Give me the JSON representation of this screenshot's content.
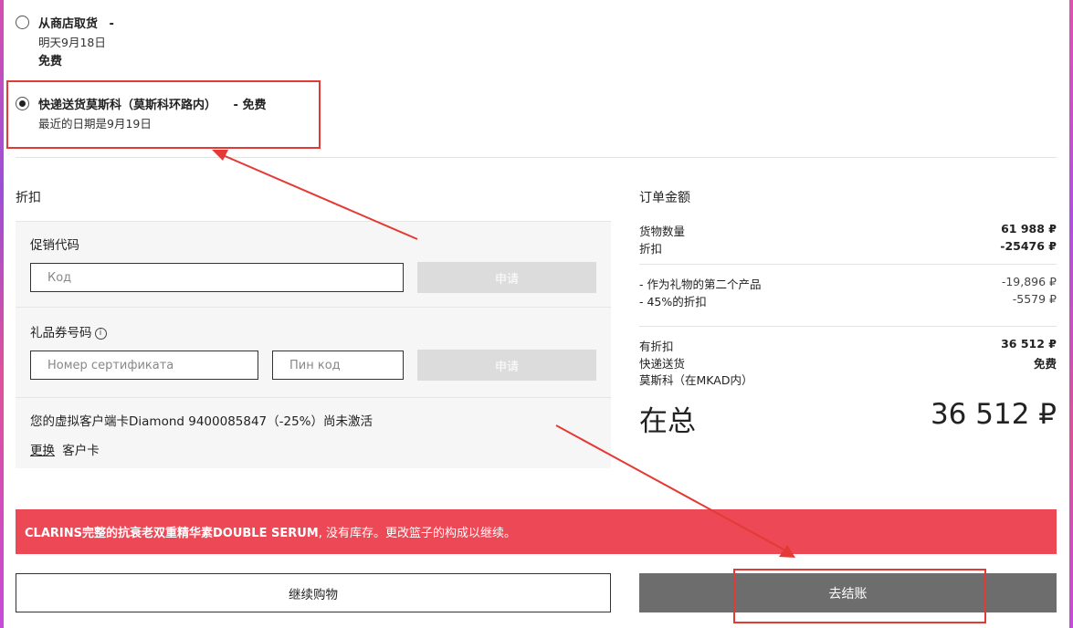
{
  "delivery": {
    "pickup": {
      "title": "从商店取货",
      "dash": "-",
      "date": "明天9月18日",
      "price": "免费",
      "selected": false
    },
    "courier": {
      "title": "快递送货莫斯科（莫斯科环路内）",
      "price_suffix": "- 免费",
      "date": "最近的日期是9月19日",
      "selected": true
    }
  },
  "discount": {
    "title": "折扣",
    "promo_label": "促销代码",
    "promo_placeholder": "Код",
    "apply_label": "申请",
    "gift_label": "礼品券号码",
    "info_icon_glyph": "i",
    "cert_placeholder": "Номер сертификата",
    "pin_placeholder": "Пин код",
    "loyalty_text": "您的虚拟客户端卡Diamond 9400085847（-25%）尚未激活",
    "change_link": "更换",
    "client_card": "客户卡"
  },
  "summary": {
    "title": "订单金额",
    "rows": [
      {
        "label": "货物数量",
        "value": "61 988 ₽"
      },
      {
        "label": "折扣",
        "value": "-25476 ₽"
      }
    ],
    "details": [
      {
        "label": "- 作为礼物的第二个产品",
        "value": "-19,896 ₽"
      },
      {
        "label": "- 45%的折扣",
        "value": "-5579 ₽"
      }
    ],
    "with_discount_label": "有折扣",
    "with_discount_value": "36 512 ₽",
    "delivery_label": "快递送货",
    "delivery_value": "免费",
    "delivery_area": "莫斯科（在MKAD内）",
    "total_label": "在总",
    "total_value": "36 512 ₽"
  },
  "alert": {
    "product": "CLARINS完整的抗衰老双重精华素DOUBLE SERUM",
    "message": ", 没有库存。更改篮子的构成以继续。"
  },
  "actions": {
    "continue_label": "继续购物",
    "checkout_label": "去结账"
  },
  "colors": {
    "alert_bg": "#ec4856",
    "checkout_bg": "#6d6d6d",
    "annotation": "#e53935"
  }
}
